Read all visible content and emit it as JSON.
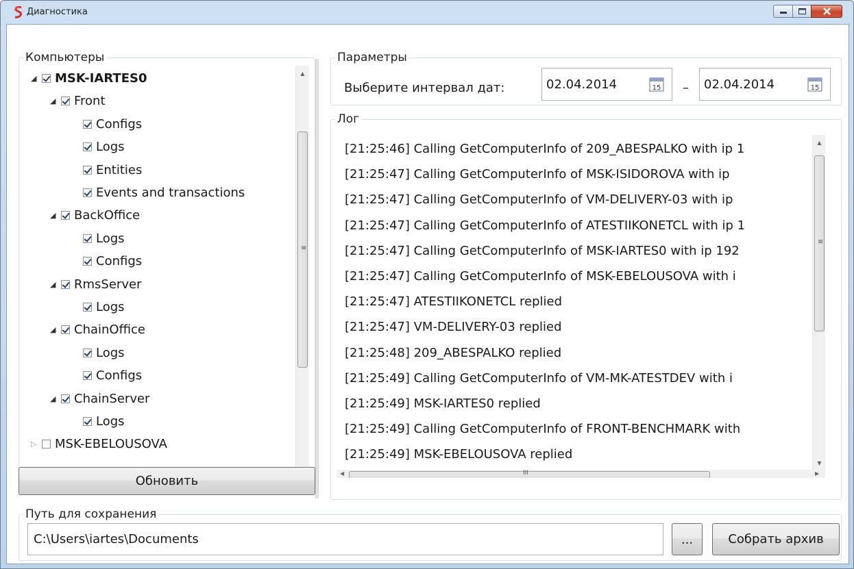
{
  "window": {
    "title": "Диагностика"
  },
  "computers": {
    "legend": "Компьютеры",
    "tree": [
      {
        "label": "MSK-IARTES0",
        "level": 0,
        "expanded": true,
        "checked": true,
        "bold": true
      },
      {
        "label": "Front",
        "level": 1,
        "expanded": true,
        "checked": true
      },
      {
        "label": "Configs",
        "level": 2,
        "checked": true
      },
      {
        "label": "Logs",
        "level": 2,
        "checked": true
      },
      {
        "label": "Entities",
        "level": 2,
        "checked": true
      },
      {
        "label": "Events and transactions",
        "level": 2,
        "checked": true
      },
      {
        "label": "BackOffice",
        "level": 1,
        "expanded": true,
        "checked": true
      },
      {
        "label": "Logs",
        "level": 2,
        "checked": true
      },
      {
        "label": "Configs",
        "level": 2,
        "checked": true
      },
      {
        "label": "RmsServer",
        "level": 1,
        "expanded": true,
        "checked": true
      },
      {
        "label": "Logs",
        "level": 2,
        "checked": true
      },
      {
        "label": "ChainOffice",
        "level": 1,
        "expanded": true,
        "checked": true
      },
      {
        "label": "Logs",
        "level": 2,
        "checked": true
      },
      {
        "label": "Configs",
        "level": 2,
        "checked": true
      },
      {
        "label": "ChainServer",
        "level": 1,
        "expanded": true,
        "checked": true
      },
      {
        "label": "Logs",
        "level": 2,
        "checked": true
      },
      {
        "label": "MSK-EBELOUSOVA",
        "level": 0,
        "expanded": false,
        "checked": false
      }
    ],
    "refresh_label": "Обновить"
  },
  "params": {
    "legend": "Параметры",
    "date_label": "Выберите интервал дат:",
    "date_from": "02.04.2014",
    "date_to": "02.04.2014",
    "dash": "–",
    "calendar_day": "15"
  },
  "log": {
    "legend": "Лог",
    "lines": [
      "[21:25:46] Calling GetComputerInfo of 209_ABESPALKO with ip 1",
      "[21:25:47] Calling GetComputerInfo of MSK-ISIDOROVA with ip",
      "[21:25:47] Calling GetComputerInfo of VM-DELIVERY-03 with ip",
      "[21:25:47] Calling GetComputerInfo of ATESTIIKONETCL with ip 1",
      "[21:25:47] Calling GetComputerInfo of MSK-IARTES0 with ip 192",
      "[21:25:47] Calling GetComputerInfo of MSK-EBELOUSOVA with i",
      "[21:25:47] ATESTIIKONETCL replied",
      "[21:25:47] VM-DELIVERY-03 replied",
      "[21:25:48] 209_ABESPALKO replied",
      "[21:25:49] Calling GetComputerInfo of VM-MK-ATESTDEV with i",
      "[21:25:49] MSK-IARTES0 replied",
      "[21:25:49] Calling GetComputerInfo of FRONT-BENCHMARK with",
      "[21:25:49] MSK-EBELOUSOVA replied"
    ]
  },
  "save": {
    "legend": "Путь для сохранения",
    "path": "C:\\Users\\iartes\\Documents",
    "browse_label": "...",
    "archive_label": "Собрать архив"
  }
}
